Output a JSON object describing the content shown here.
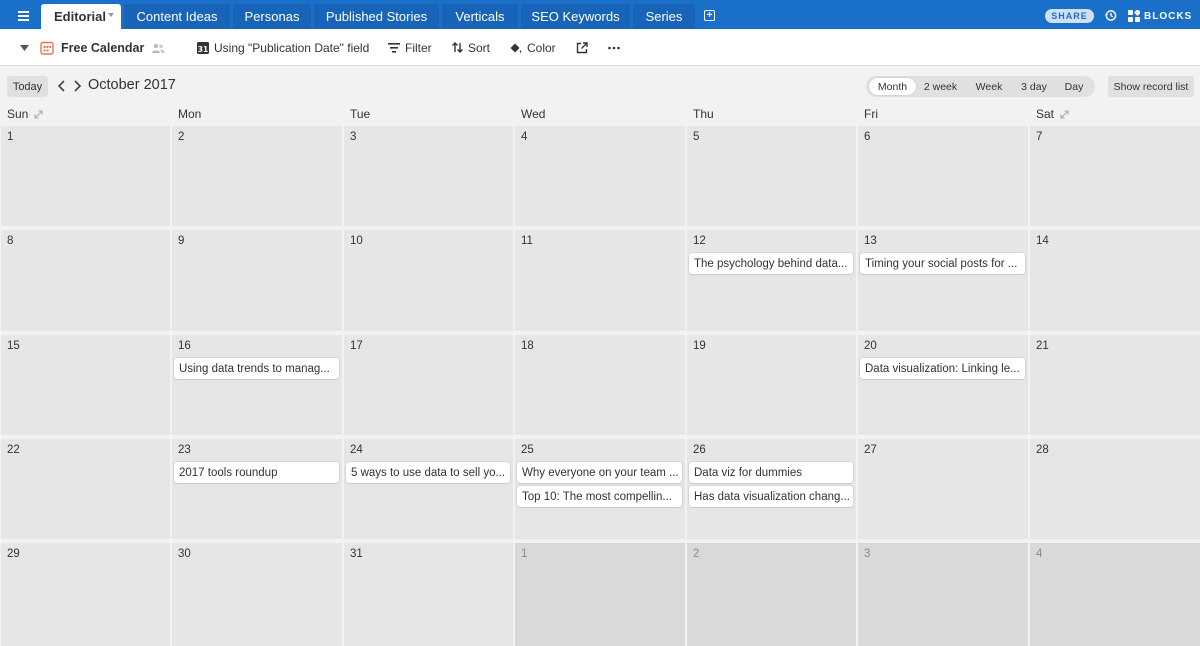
{
  "tabs": [
    {
      "label": "Editorial",
      "active": true
    },
    {
      "label": "Content Ideas"
    },
    {
      "label": "Personas"
    },
    {
      "label": "Published Stories"
    },
    {
      "label": "Verticals"
    },
    {
      "label": "SEO Keywords"
    },
    {
      "label": "Series"
    }
  ],
  "topbar": {
    "share_label": "SHARE",
    "blocks_label": "BLOCKS",
    "accent": "#1a6fc9"
  },
  "toolbar": {
    "view_name": "Free Calendar",
    "date_field": "Using \"Publication Date\" field",
    "filter": "Filter",
    "sort": "Sort",
    "color": "Color"
  },
  "nav": {
    "today": "Today",
    "month_title": "October 2017",
    "range_options": [
      "Month",
      "2 week",
      "Week",
      "3 day",
      "Day"
    ],
    "active_range": "Month",
    "show_record_list": "Show record list"
  },
  "weekdays": [
    "Sun",
    "Mon",
    "Tue",
    "Wed",
    "Thu",
    "Fri",
    "Sat"
  ],
  "weeks": [
    [
      {
        "day": "1"
      },
      {
        "day": "2"
      },
      {
        "day": "3"
      },
      {
        "day": "4"
      },
      {
        "day": "5"
      },
      {
        "day": "6"
      },
      {
        "day": "7"
      }
    ],
    [
      {
        "day": "8"
      },
      {
        "day": "9"
      },
      {
        "day": "10"
      },
      {
        "day": "11"
      },
      {
        "day": "12",
        "events": [
          "The psychology behind data..."
        ]
      },
      {
        "day": "13",
        "events": [
          "Timing your social posts for ..."
        ]
      },
      {
        "day": "14"
      }
    ],
    [
      {
        "day": "15"
      },
      {
        "day": "16",
        "events": [
          "Using data trends to manag..."
        ]
      },
      {
        "day": "17"
      },
      {
        "day": "18"
      },
      {
        "day": "19"
      },
      {
        "day": "20",
        "events": [
          "Data visualization: Linking le..."
        ]
      },
      {
        "day": "21"
      }
    ],
    [
      {
        "day": "22"
      },
      {
        "day": "23",
        "events": [
          "2017 tools roundup"
        ]
      },
      {
        "day": "24",
        "events": [
          "5 ways to use data to sell yo..."
        ]
      },
      {
        "day": "25",
        "events": [
          "Why everyone on your team ...",
          "Top 10: The most compellin..."
        ]
      },
      {
        "day": "26",
        "events": [
          "Data viz for dummies",
          "Has data visualization chang..."
        ]
      },
      {
        "day": "27"
      },
      {
        "day": "28"
      }
    ],
    [
      {
        "day": "29"
      },
      {
        "day": "30"
      },
      {
        "day": "31"
      },
      {
        "day": "1",
        "other": true
      },
      {
        "day": "2",
        "other": true
      },
      {
        "day": "3",
        "other": true
      },
      {
        "day": "4",
        "other": true
      }
    ]
  ]
}
